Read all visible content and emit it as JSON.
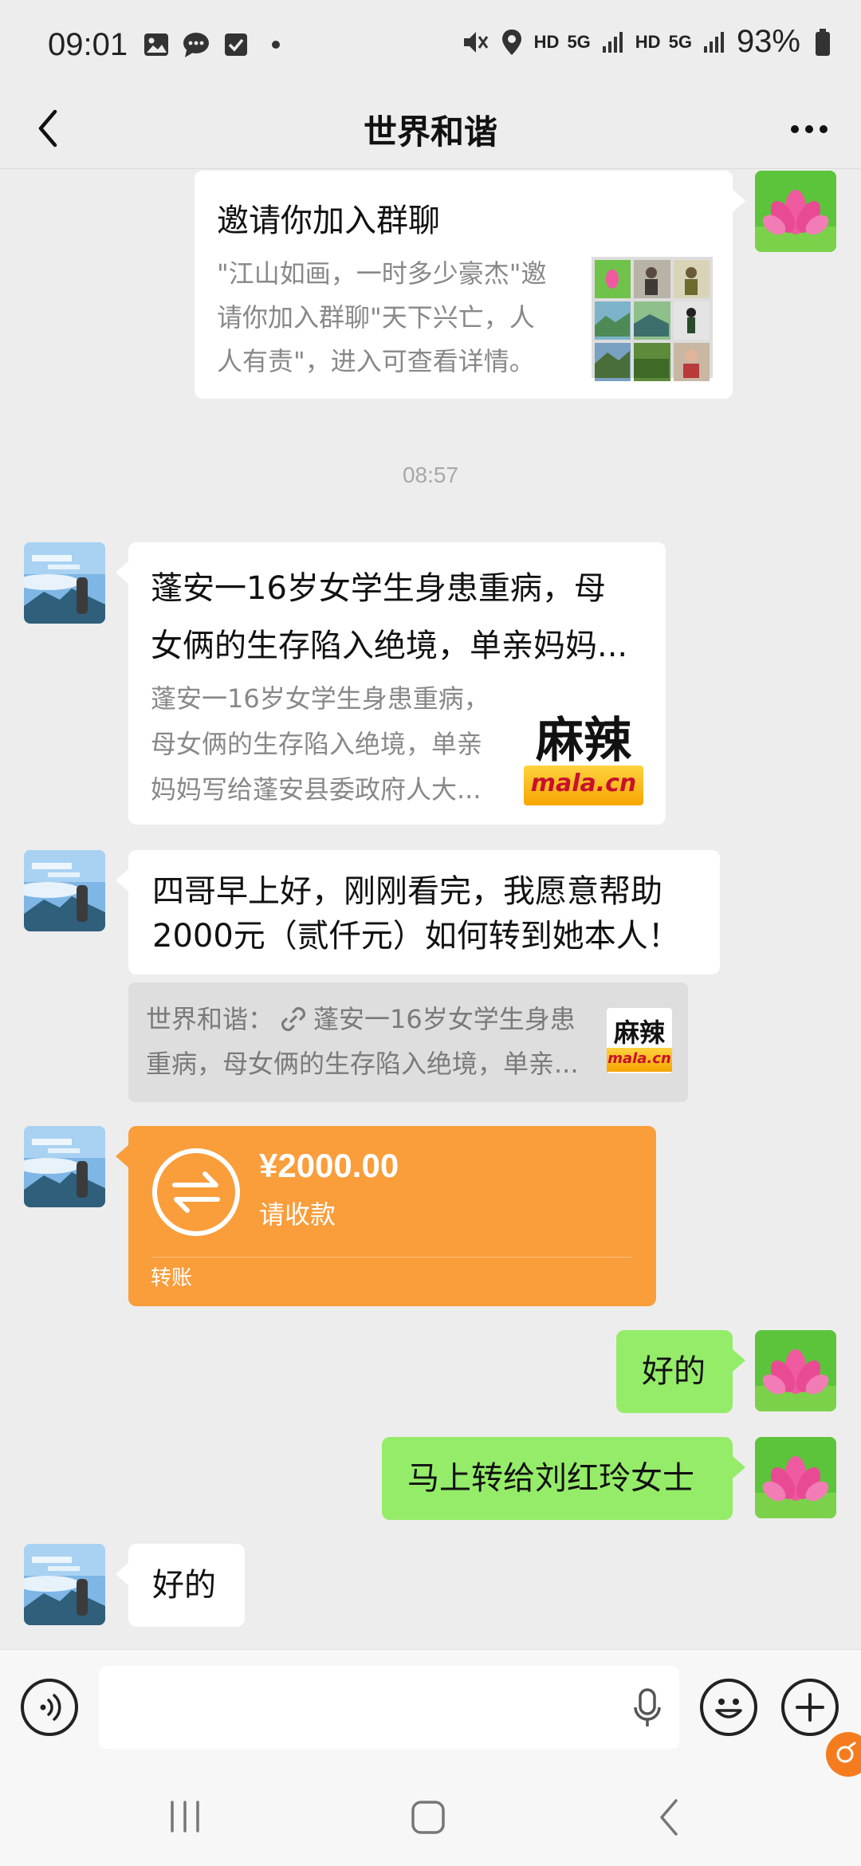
{
  "status_bar": {
    "time": "09:01",
    "hd1": "HD",
    "net1": "5G",
    "hd2": "HD",
    "net2": "5G",
    "battery": "93%"
  },
  "header": {
    "title": "世界和谐"
  },
  "messages": {
    "invite": {
      "title": "邀请你加入群聊",
      "desc_line1": "\"江山如画，一时多少豪杰\"邀",
      "desc_line2": "请你加入群聊\"天下兴亡，人",
      "desc_line3": "人有责\"，进入可查看详情。"
    },
    "time_divider": "08:57",
    "article": {
      "title_line1": "蓬安一16岁女学生身患重病，母",
      "title_line2": "女俩的生存陷入绝境，单亲妈妈...",
      "desc_line1": "蓬安一16岁女学生身患重病，",
      "desc_line2": "母女俩的生存陷入绝境，单亲",
      "desc_line3": "妈妈写给蓬安县委政府人大...",
      "logo_cn": "麻辣",
      "logo_en": "mala.cn"
    },
    "reply": {
      "line1": "四哥早上好，刚刚看完，我愿意帮助",
      "line2": "2000元（贰仟元）如何转到她本人！"
    },
    "quote": {
      "line1": "世界和谐：",
      "line1b": "蓬安一16岁女学生身患",
      "line2": "重病，母女俩的生存陷入绝境，单亲...",
      "logo_cn": "麻辣",
      "logo_en": "mala.cn"
    },
    "transfer": {
      "amount": "¥2000.00",
      "action": "请收款",
      "label": "转账"
    },
    "sent1": "好的",
    "sent2": "马上转给刘红玲女士",
    "received_last": "好的"
  },
  "colors": {
    "bg": "#ededed",
    "green_bubble": "#95ec69",
    "transfer": "#fa9d3b"
  }
}
